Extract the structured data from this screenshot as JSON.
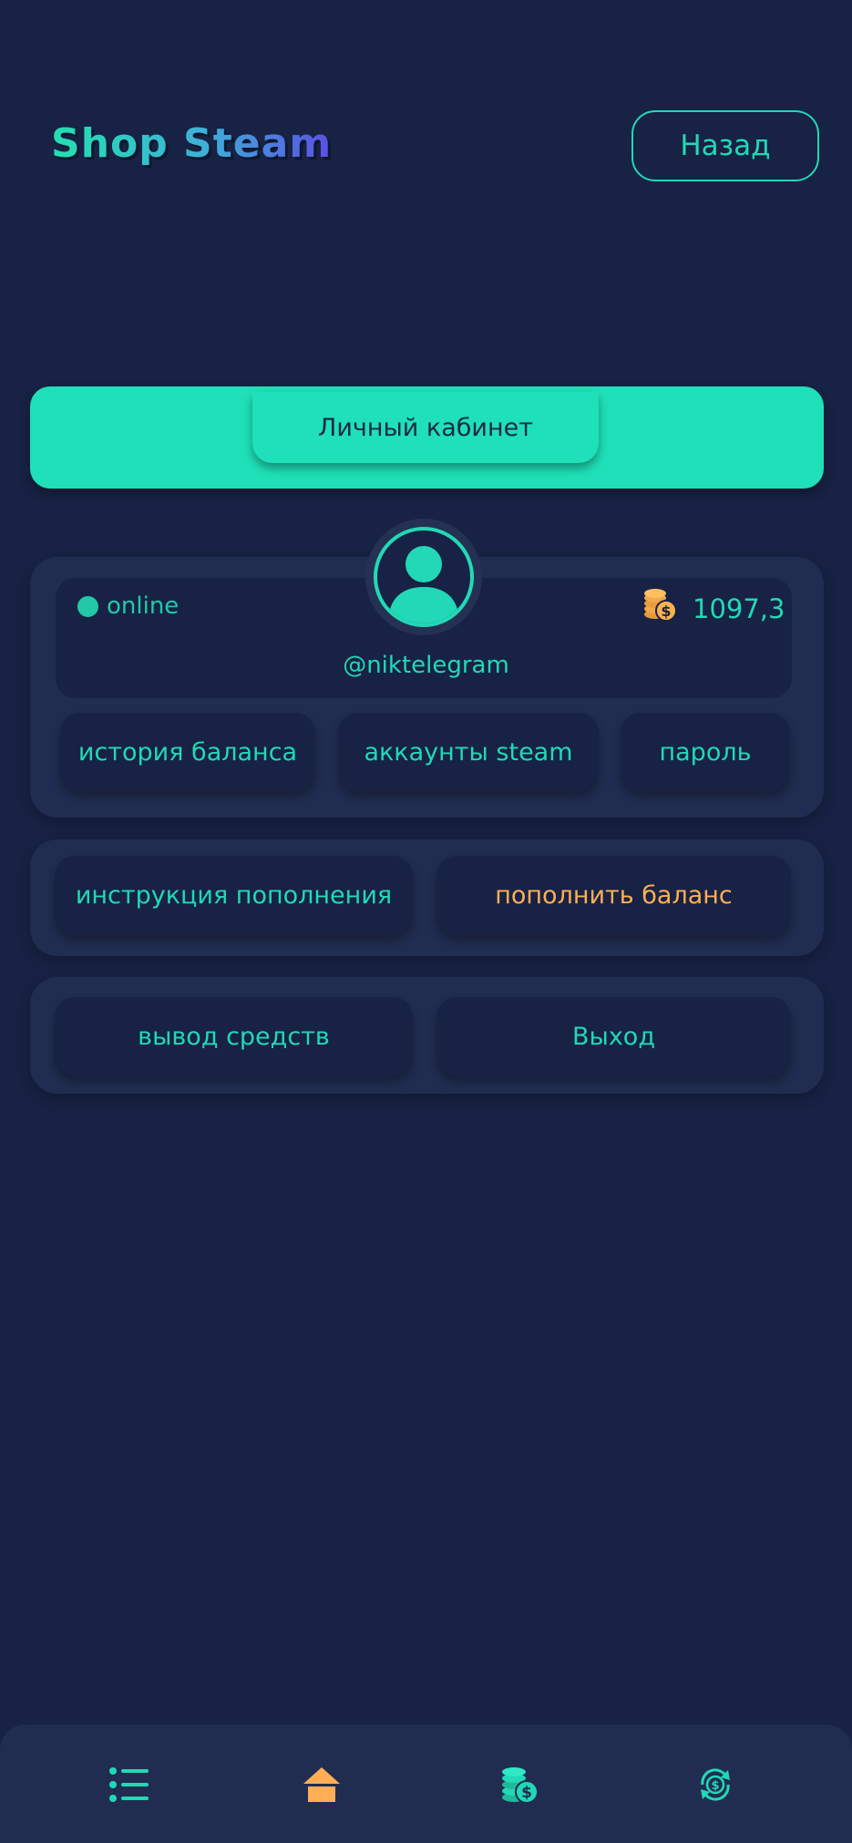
{
  "header": {
    "logo_text": "Shop Steam",
    "back_label": "Назад"
  },
  "cabinet": {
    "title": "Личный кабинет"
  },
  "profile": {
    "status": "online",
    "balance": "1097,3",
    "username": "@niktelegram",
    "buttons": {
      "history": "история баланса",
      "accounts": "аккаунты steam",
      "password": "пароль"
    }
  },
  "funds": {
    "instruction": "инструкция пополнения",
    "topup": "пополнить баланс"
  },
  "exit_row": {
    "withdraw": "вывод средств",
    "logout": "Выход"
  },
  "nav": {
    "items": [
      "list-icon",
      "home-icon",
      "coins-icon",
      "exchange-icon"
    ]
  },
  "colors": {
    "background": "#172244",
    "panel": "#202d50",
    "accent": "#22d8b6",
    "orange": "#ffae55"
  }
}
